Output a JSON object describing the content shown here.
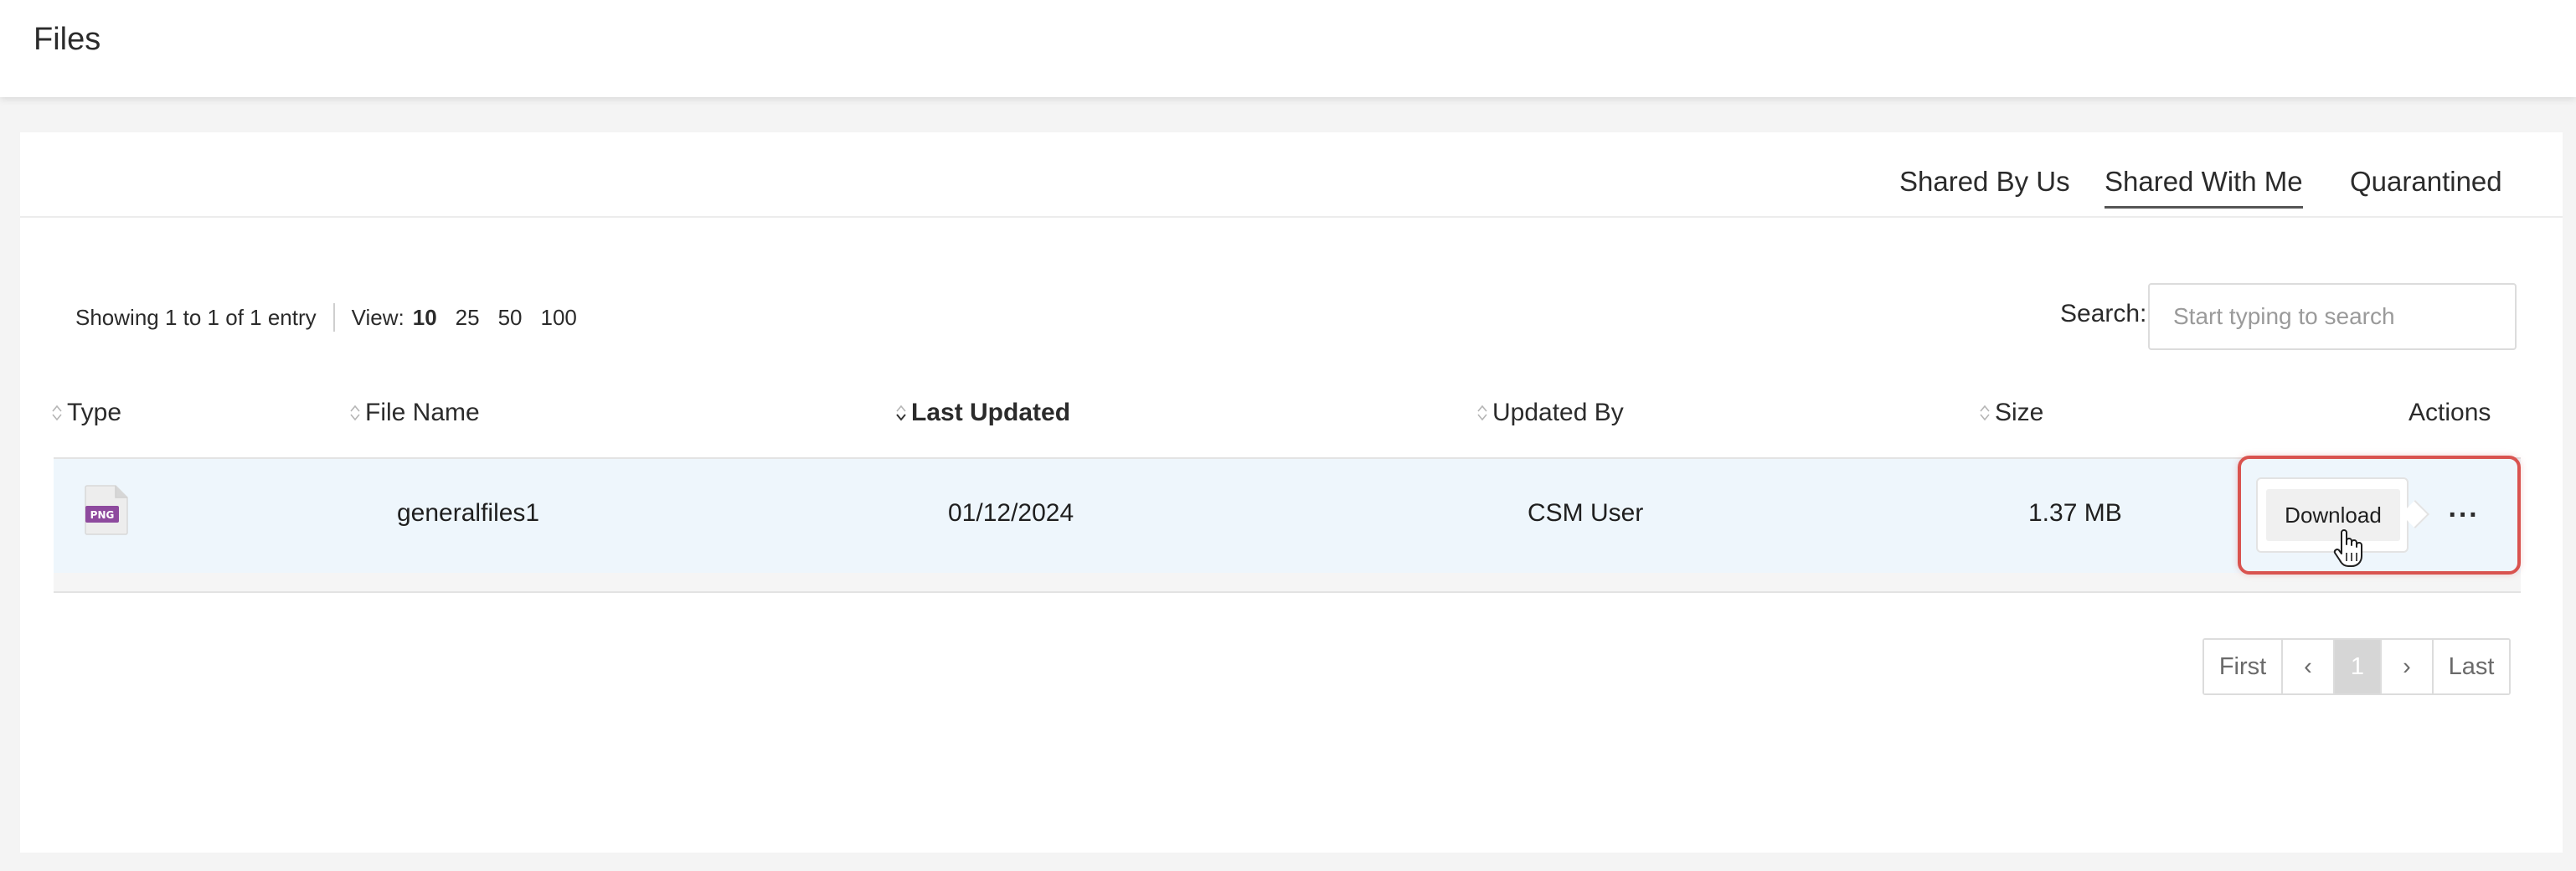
{
  "header": {
    "title": "Files"
  },
  "tabs": [
    {
      "label": "Shared By Us",
      "active": false
    },
    {
      "label": "Shared With Me",
      "active": true
    },
    {
      "label": "Quarantined",
      "active": false
    }
  ],
  "entries": {
    "summary": "Showing 1 to 1 of 1 entry",
    "view_label": "View:",
    "view_options": [
      "10",
      "25",
      "50",
      "100"
    ],
    "view_selected": "10"
  },
  "search": {
    "label": "Search:",
    "placeholder": "Start typing to search",
    "value": ""
  },
  "table": {
    "columns": [
      "Type",
      "File Name",
      "Last Updated",
      "Updated By",
      "Size",
      "Actions"
    ],
    "sorted_column": "Last Updated",
    "rows": [
      {
        "type": "PNG",
        "file_name": "generalfiles1",
        "last_updated": "01/12/2024",
        "updated_by": "CSM User",
        "size": "1.37 MB"
      }
    ],
    "row_actions": {
      "download_label": "Download",
      "more_label": "···"
    }
  },
  "pagination": {
    "first": "First",
    "prev": "‹",
    "pages": [
      "1"
    ],
    "current": "1",
    "next": "›",
    "last": "Last"
  },
  "colors": {
    "row_highlight": "#eef6fc",
    "annotation_box": "#d9534f",
    "file_icon": "#8e4a9e"
  },
  "icons": {
    "sort": "sort-updown-icon",
    "sort_active": "sort-desc-icon",
    "file": "png-file-icon",
    "cursor": "hand-pointer-icon",
    "more": "ellipsis-icon"
  }
}
